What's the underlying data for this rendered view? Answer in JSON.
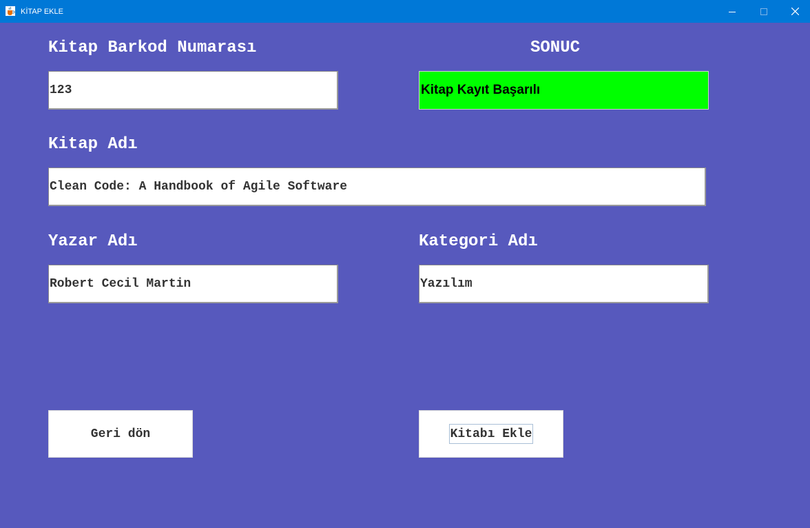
{
  "window": {
    "title": "KİTAP EKLE",
    "icon": "java-cup-icon",
    "controls": [
      "minimize-icon",
      "maximize-icon",
      "close-icon"
    ]
  },
  "colors": {
    "background": "#5759BD",
    "titlebar": "#0078D7",
    "success": "#00FF00"
  },
  "form": {
    "barcode_label": "Kitap Barkod Numarası",
    "barcode_value": "123",
    "result_label": "SONUC",
    "result_value": "Kitap Kayıt Başarılı",
    "book_name_label": "Kitap Adı",
    "book_name_value": "Clean Code: A Handbook of Agile Software",
    "author_label": "Yazar Adı",
    "author_value": "Robert Cecil Martin",
    "category_label": "Kategori Adı",
    "category_value": "Yazılım"
  },
  "buttons": {
    "back_label": "Geri dön",
    "add_label": "Kitabı Ekle"
  }
}
